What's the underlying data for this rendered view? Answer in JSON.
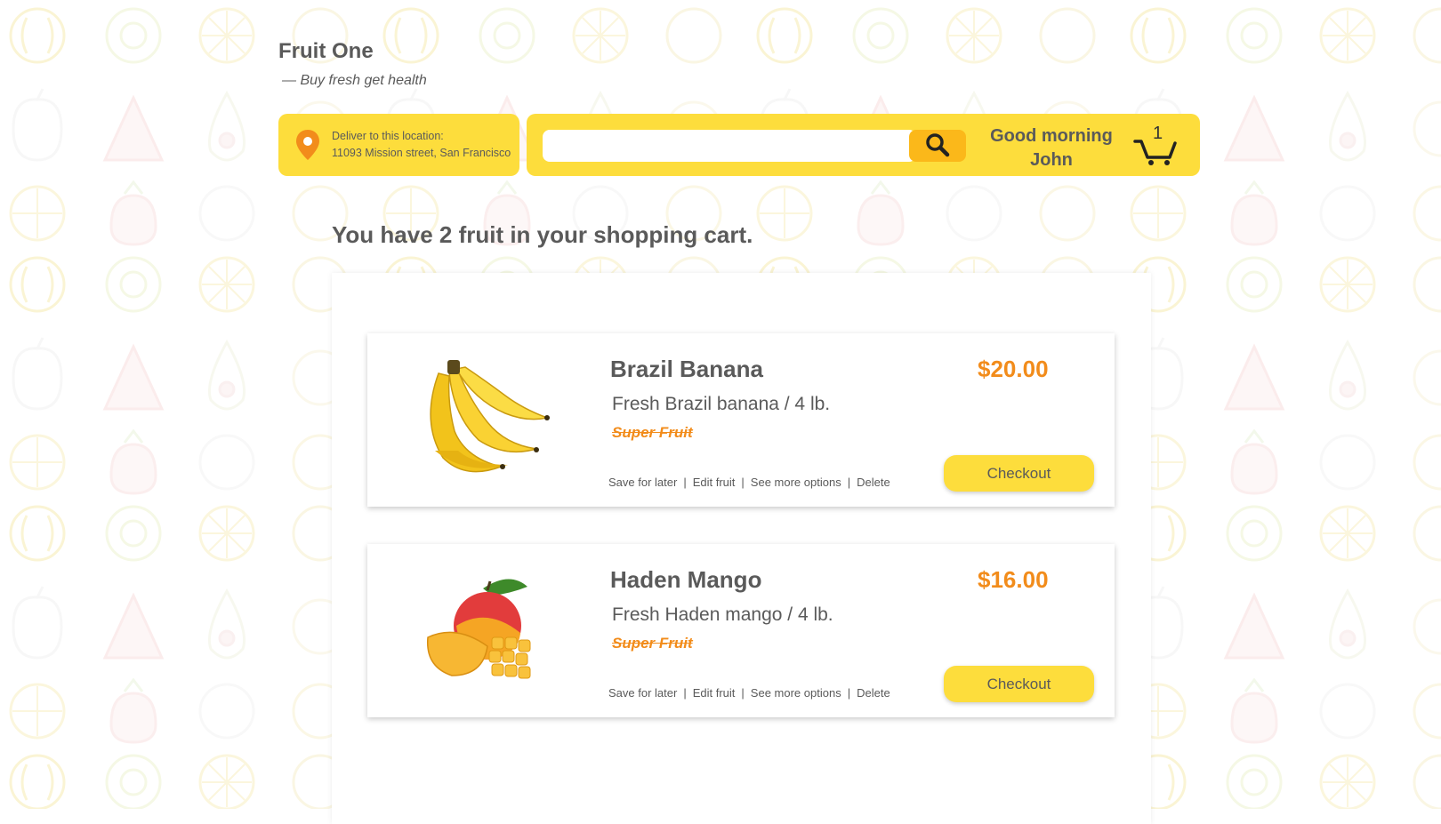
{
  "brand": {
    "name": "Fruit One",
    "tagline": "— Buy fresh get health"
  },
  "location": {
    "label": "Deliver to this location:",
    "address": "11093 Mission street, San Francisco"
  },
  "search": {
    "placeholder": "",
    "value": ""
  },
  "header": {
    "greeting_line1": "Good morning",
    "greeting_line2": "John",
    "cart_count": "1"
  },
  "cart": {
    "heading": "You have 2 fruit in your shopping cart.",
    "items": [
      {
        "name": "Brazil Banana",
        "description": "Fresh Brazil banana / 4 lb.",
        "badge": "Super Fruit",
        "price": "$20.00",
        "actions": [
          "Save for later",
          "Edit fruit",
          "See more options",
          "Delete"
        ],
        "checkout_label": "Checkout",
        "image_icon": "banana-bunch"
      },
      {
        "name": "Haden Mango",
        "description": "Fresh Haden mango / 4 lb.",
        "badge": "Super Fruit",
        "price": "$16.00",
        "actions": [
          "Save for later",
          "Edit fruit",
          "See more options",
          "Delete"
        ],
        "checkout_label": "Checkout",
        "image_icon": "mango-cut"
      }
    ]
  },
  "colors": {
    "accent_yellow": "#fddd3c",
    "search_button": "#fbb81a",
    "price_orange": "#f28c1b",
    "text_gray": "#5a5a5a",
    "background_pattern": "fruit-icons"
  }
}
